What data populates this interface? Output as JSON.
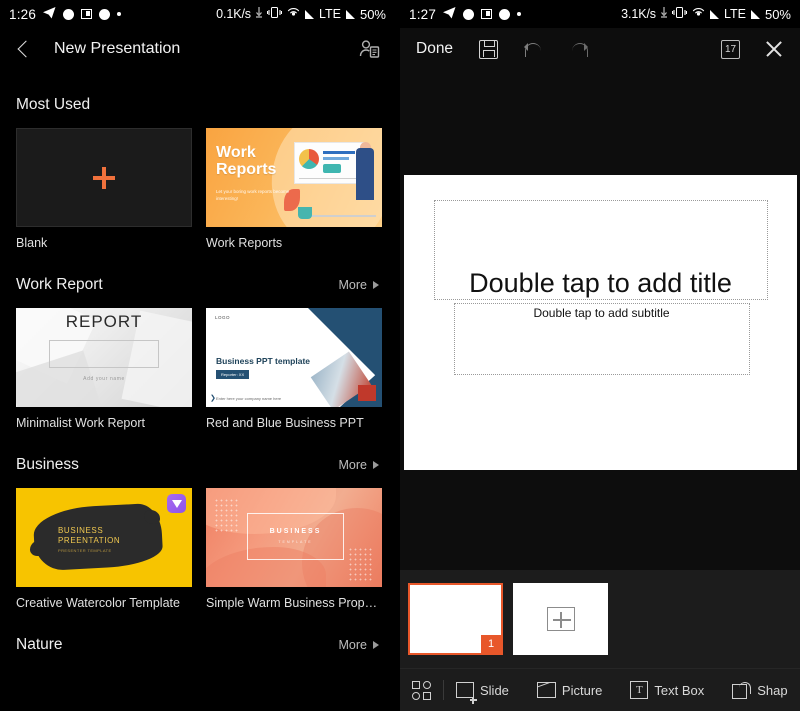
{
  "left_panel": {
    "status_bar": {
      "time": "1:26",
      "net_speed": "0.1K/s",
      "network_type": "LTE",
      "battery": "50%",
      "icons": [
        "telegram-icon",
        "circle-icon",
        "screenshot-icon",
        "circle-icon",
        "dot-icon",
        "download-arrow-icon",
        "vibrate-icon",
        "hotspot-icon",
        "signal-icon",
        "signal-icon"
      ]
    },
    "appbar": {
      "back_icon": "back-chevron-icon",
      "title": "New Presentation",
      "account_icon": "account-document-icon"
    },
    "sections": [
      {
        "title": "Most Used",
        "more_label": "",
        "has_more": false,
        "templates": [
          {
            "label": "Blank",
            "kind": "blank",
            "vip": false
          },
          {
            "label": "Work Reports",
            "kind": "work-reports",
            "vip": false,
            "thumb_text": {
              "title_line1": "Work",
              "title_line2": "Reports",
              "subtitle": "Let your boring work reports become interesting!"
            }
          }
        ]
      },
      {
        "title": "Work Report",
        "more_label": "More",
        "has_more": true,
        "templates": [
          {
            "label": "Minimalist Work Report",
            "kind": "minimal-report",
            "vip": false,
            "thumb_text": {
              "word": "REPORT",
              "subtitle": "Add your name"
            }
          },
          {
            "label": "Red and Blue Business PPT",
            "kind": "red-blue",
            "vip": false,
            "thumb_text": {
              "logo": "LOGO",
              "title": "Business PPT template",
              "pill": "Reporter: XX",
              "footer": "Enter here your company name here"
            }
          }
        ]
      },
      {
        "title": "Business",
        "more_label": "More",
        "has_more": true,
        "templates": [
          {
            "label": "Creative Watercolor Template",
            "kind": "watercolor",
            "vip": true,
            "thumb_text": {
              "line1": "BUSINESS",
              "line2": "PREENTATION",
              "line3": "PRESENTER              TEMPLATE"
            }
          },
          {
            "label": "Simple Warm Business Proposal F...",
            "kind": "warm-business",
            "vip": false,
            "thumb_text": {
              "line1": "BUSINESS",
              "line2": "TEMPLATE"
            }
          }
        ]
      },
      {
        "title": "Nature",
        "more_label": "More",
        "has_more": true,
        "templates": []
      }
    ]
  },
  "right_panel": {
    "status_bar": {
      "time": "1:27",
      "net_speed": "3.1K/s",
      "network_type": "LTE",
      "battery": "50%"
    },
    "appbar": {
      "done_label": "Done",
      "save_icon": "save-floppy-icon",
      "undo_icon": "undo-icon",
      "redo_icon": "redo-icon",
      "calendar_label": "17",
      "calendar_icon": "calendar-icon",
      "close_icon": "close-icon"
    },
    "slide": {
      "title_placeholder": "Double tap to add title",
      "subtitle_placeholder": "Double tap to add subtitle"
    },
    "slide_strip": {
      "slides": [
        {
          "number": "1",
          "active": true
        }
      ],
      "add_slide_icon": "plus-square-icon"
    },
    "bottom_toolbar": {
      "grid_icon": "grid-view-icon",
      "items": [
        {
          "label": "Slide",
          "icon": "add-slide-icon"
        },
        {
          "label": "Picture",
          "icon": "picture-icon"
        },
        {
          "label": "Text Box",
          "icon": "text-box-icon"
        },
        {
          "label": "Shap",
          "icon": "shape-icon"
        }
      ]
    }
  },
  "colors": {
    "accent_orange": "#e8572a",
    "plus_orange": "#f0713c",
    "background": "#000000",
    "panel_bg": "#0d0d0d",
    "strip_bg": "#1c1c1c",
    "vip_purple": "#8e54e9"
  }
}
